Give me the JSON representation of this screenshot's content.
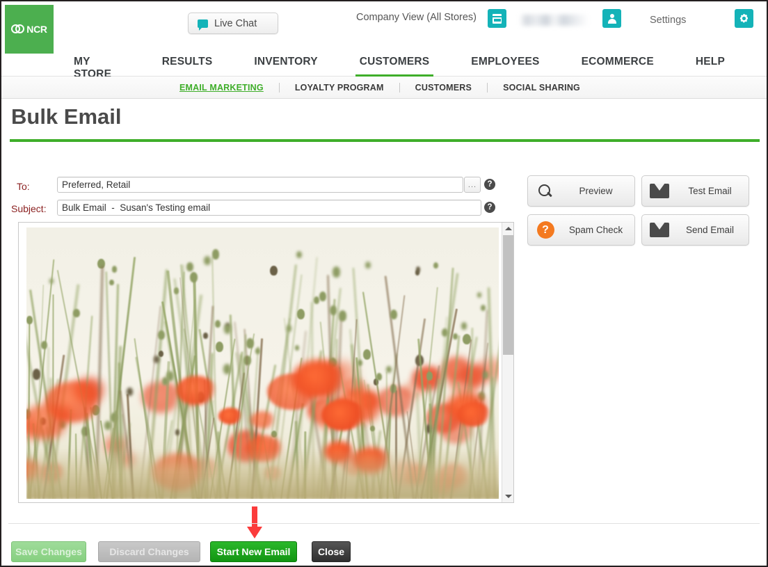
{
  "header": {
    "logo_text": "NCR",
    "live_chat_label": "Live Chat",
    "company_view": "Company View (All Stores)",
    "settings_label": "Settings",
    "store_icon": "store-icon",
    "person_icon": "person-icon",
    "gear_icon": "gear-icon",
    "chat_icon": "chat-bubble-icon",
    "username": ""
  },
  "mainnav": {
    "items": [
      {
        "label": "MY STORE",
        "active": false
      },
      {
        "label": "RESULTS",
        "active": false
      },
      {
        "label": "INVENTORY",
        "active": false
      },
      {
        "label": "CUSTOMERS",
        "active": true
      },
      {
        "label": "EMPLOYEES",
        "active": false
      },
      {
        "label": "ECOMMERCE",
        "active": false
      },
      {
        "label": "HELP",
        "active": false
      }
    ]
  },
  "subnav": {
    "items": [
      {
        "label": "EMAIL MARKETING",
        "active": true
      },
      {
        "label": "LOYALTY PROGRAM",
        "active": false
      },
      {
        "label": "CUSTOMERS",
        "active": false
      },
      {
        "label": "SOCIAL SHARING",
        "active": false
      }
    ]
  },
  "page": {
    "title": "Bulk Email"
  },
  "form": {
    "to_label": "To:",
    "to_value": "Preferred, Retail",
    "to_placeholder": "",
    "to_picker_label": "...",
    "subject_label": "Subject:",
    "subject_value": "Bulk Email  -  Susan's Testing email",
    "subject_placeholder": "",
    "help_glyph": "?"
  },
  "actions": {
    "preview": {
      "label": "Preview",
      "icon": "search-icon"
    },
    "test_email": {
      "label": "Test Email",
      "icon": "envelope-icon"
    },
    "spam_check": {
      "label": "Spam Check",
      "icon": "question-circle-icon"
    },
    "send_email": {
      "label": "Send Email",
      "icon": "envelope-icon"
    }
  },
  "preview_panel": {
    "content_description": "Blurred photograph of a poppy field with orange poppies and green seed pods against a pale sky",
    "scroll_up_icon": "triangle-up-icon",
    "scroll_down_icon": "triangle-down-icon"
  },
  "footer": {
    "save_label": "Save Changes",
    "discard_label": "Discard Changes",
    "start_new_label": "Start New Email",
    "close_label": "Close"
  },
  "annotation": {
    "arrow": "red-down-arrow",
    "points_to": "Start New Email"
  },
  "colors": {
    "brand_green": "#4caf4f",
    "accent_green": "#3fae2a",
    "teal": "#14b3b8",
    "orange": "#f47a20",
    "label_red": "#8a1f1f",
    "annotation_red": "#fb3b3b",
    "start_new_green": "#129512"
  }
}
